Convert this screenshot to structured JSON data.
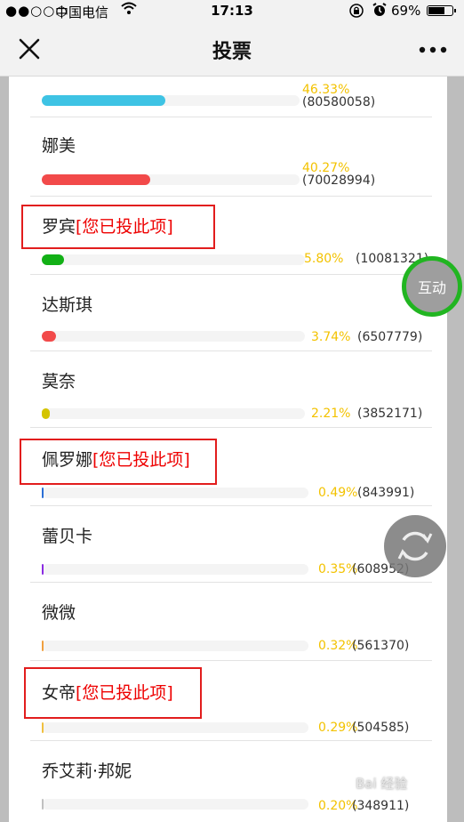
{
  "status_bar": {
    "signal": "●●○○○",
    "carrier": "中国电信",
    "time": "17:13",
    "battery": "69%"
  },
  "nav": {
    "title": "投票"
  },
  "voted_tag": "[您已投此项]",
  "items": [
    {
      "name": "",
      "percent": "46.33%",
      "count": "(80580058)",
      "fraction": 0.33,
      "color": "#3ec3e4"
    },
    {
      "name": "娜美",
      "percent": "40.27%",
      "count": "(70028994)",
      "fraction": 0.29,
      "color": "#f24a4a"
    },
    {
      "name": "罗宾",
      "voted": true,
      "percent": "5.80%",
      "count": "(10081321)",
      "fraction": 0.058,
      "color": "#12b016"
    },
    {
      "name": "达斯琪",
      "percent": "3.74%",
      "count": "(6507779)",
      "fraction": 0.037,
      "color": "#f24a4a"
    },
    {
      "name": "莫奈",
      "percent": "2.21%",
      "count": "(3852171)",
      "fraction": 0.022,
      "color": "#d4c400"
    },
    {
      "name": "佩罗娜",
      "voted": true,
      "percent": "0.49%",
      "count": "(843991)",
      "fraction": 0.005,
      "color": "#2b6fd6"
    },
    {
      "name": "蕾贝卡",
      "percent": "0.35%",
      "count": "(608952)",
      "fraction": 0.004,
      "color": "#8a2be2"
    },
    {
      "name": "微微",
      "percent": "0.32%",
      "count": "(561370)",
      "fraction": 0.003,
      "color": "#f0a040"
    },
    {
      "name": "女帝",
      "voted": true,
      "percent": "0.29%",
      "count": "(504585)",
      "fraction": 0.003,
      "color": "#f0c040"
    },
    {
      "name": "乔艾莉·邦妮",
      "percent": "0.20%",
      "count": "(348911)",
      "fraction": 0.002,
      "color": "#c0c0c0"
    }
  ],
  "floating": {
    "hudong_label": "互动"
  },
  "watermark": "Bai 经验"
}
